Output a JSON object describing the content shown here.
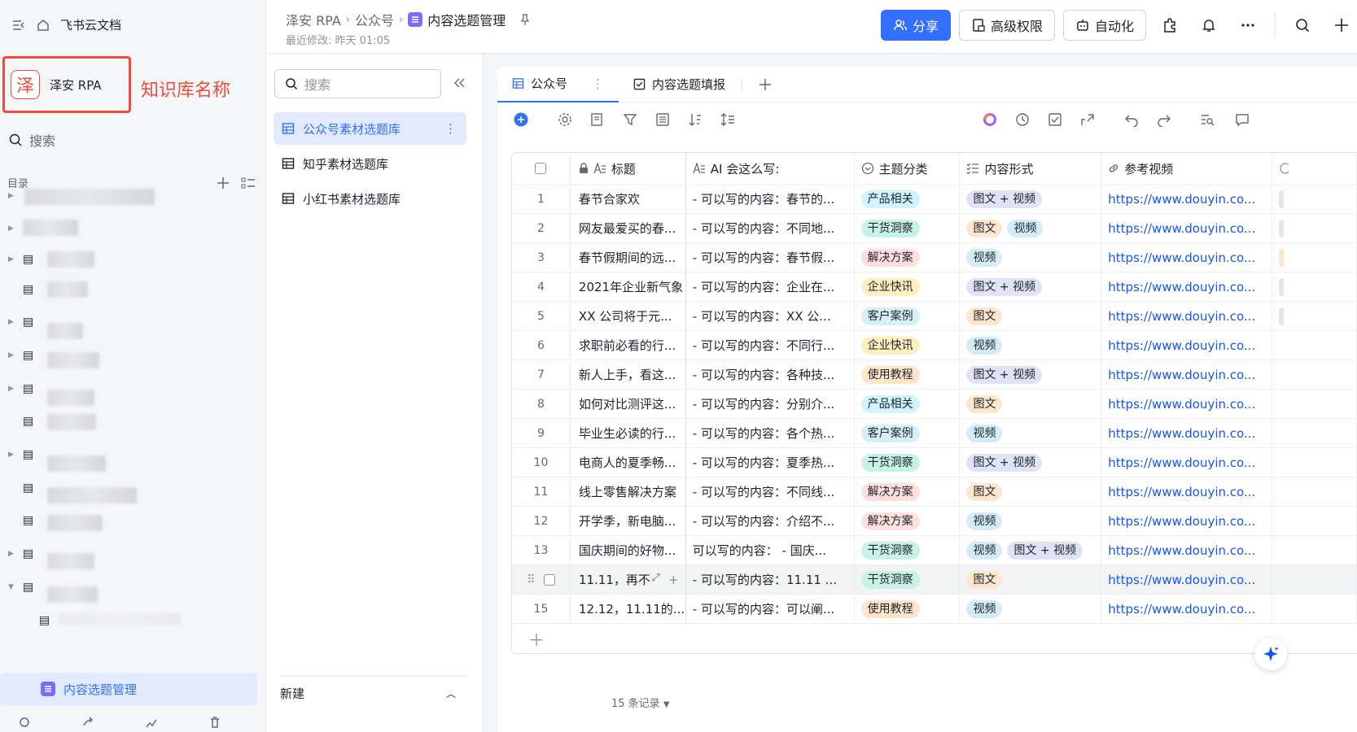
{
  "sidebar": {
    "app_name": "飞书云文档",
    "kb_logo_char": "泽",
    "kb_name": "泽安 RPA",
    "kb_annotation": "知识库名称",
    "search_placeholder": "搜索",
    "toc_label": "目录",
    "active_item": "内容选题管理"
  },
  "header": {
    "breadcrumb": [
      "泽安 RPA",
      "公众号",
      "内容选题管理"
    ],
    "last_modified": "最近修改: 昨天 01:05",
    "share_label": "分享",
    "permissions_label": "高级权限",
    "automation_label": "自动化"
  },
  "panel": {
    "search_placeholder": "搜索",
    "items": [
      "公众号素材选题库",
      "知乎素材选题库",
      "小红书素材选题库"
    ],
    "new_label": "新建"
  },
  "tabs": [
    "公众号",
    "内容选题填报"
  ],
  "table": {
    "columns": [
      "标题",
      "AI 会这么写:",
      "主题分类",
      "内容形式",
      "参考视频"
    ],
    "rows": [
      {
        "n": "1",
        "title": "春节合家欢",
        "ai": "- 可以写的内容：春节的...",
        "cat": "产品相关",
        "forms": [
          "图文 + 视频"
        ],
        "link": "https://www.douyin.co..."
      },
      {
        "n": "2",
        "title": "网友最爱买的春...",
        "ai": "- 可以写的内容：不同地...",
        "cat": "干货洞察",
        "forms": [
          "图文",
          "视频"
        ],
        "link": "https://www.douyin.co..."
      },
      {
        "n": "3",
        "title": "春节假期间的远...",
        "ai": "- 可以写的内容：春节假...",
        "cat": "解决方案",
        "forms": [
          "视频"
        ],
        "link": "https://www.douyin.co..."
      },
      {
        "n": "4",
        "title": "2021年企业新气象",
        "ai": "- 可以写的内容：企业在...",
        "cat": "企业快讯",
        "forms": [
          "图文 + 视频"
        ],
        "link": "https://www.douyin.co..."
      },
      {
        "n": "5",
        "title": "XX 公司将于元...",
        "ai": "- 可以写的内容：XX 公...",
        "cat": "客户案例",
        "forms": [
          "图文"
        ],
        "link": "https://www.douyin.co..."
      },
      {
        "n": "6",
        "title": "求职前必看的行...",
        "ai": "- 可以写的内容：不同行...",
        "cat": "企业快讯",
        "forms": [
          "视频"
        ],
        "link": "https://www.douyin.co..."
      },
      {
        "n": "7",
        "title": "新人上手，看这...",
        "ai": "- 可以写的内容：各种技...",
        "cat": "使用教程",
        "forms": [
          "图文 + 视频"
        ],
        "link": "https://www.douyin.co..."
      },
      {
        "n": "8",
        "title": "如何对比测评这...",
        "ai": "- 可以写的内容：分别介...",
        "cat": "产品相关",
        "forms": [
          "图文"
        ],
        "link": "https://www.douyin.co..."
      },
      {
        "n": "9",
        "title": "毕业生必读的行...",
        "ai": "- 可以写的内容：各个热...",
        "cat": "客户案例",
        "forms": [
          "视频"
        ],
        "link": "https://www.douyin.co..."
      },
      {
        "n": "10",
        "title": "电商人的夏季畅...",
        "ai": "- 可以写的内容：夏季热...",
        "cat": "干货洞察",
        "forms": [
          "图文 + 视频"
        ],
        "link": "https://www.douyin.co..."
      },
      {
        "n": "11",
        "title": "线上零售解决方案",
        "ai": "- 可以写的内容：不同线...",
        "cat": "解决方案",
        "forms": [
          "图文"
        ],
        "link": "https://www.douyin.co..."
      },
      {
        "n": "12",
        "title": "开学季，新电脑...",
        "ai": "- 可以写的内容：介绍不...",
        "cat": "解决方案",
        "forms": [
          "视频"
        ],
        "link": "https://www.douyin.co..."
      },
      {
        "n": "13",
        "title": "国庆期间的好物...",
        "ai": "可以写的内容：  - 国庆...",
        "cat": "干货洞察",
        "forms": [
          "视频",
          "图文 + 视频"
        ],
        "link": "https://www.douyin.co..."
      },
      {
        "n": "",
        "title": "11.11，再不",
        "ai": "- 可以写的内容：11.11 ...",
        "cat": "干货洞察",
        "forms": [
          "图文"
        ],
        "link": "https://www.douyin.co..."
      },
      {
        "n": "15",
        "title": "12.12，11.11的...",
        "ai": "- 可以写的内容：可以阐...",
        "cat": "使用教程",
        "forms": [
          "视频"
        ],
        "link": "https://www.douyin.co..."
      }
    ],
    "record_count": "15 条记录"
  },
  "colors": {
    "产品相关": "#d1f2ff",
    "干货洞察": "#c8f2e5",
    "解决方案": "#ffe0de",
    "企业快讯": "#fcefc0",
    "客户案例": "#d6f0f7",
    "使用教程": "#ffe5cc",
    "图文 + 视频": "#dfe3f5",
    "图文": "#fde6cf",
    "视频": "#d3ecf5"
  }
}
